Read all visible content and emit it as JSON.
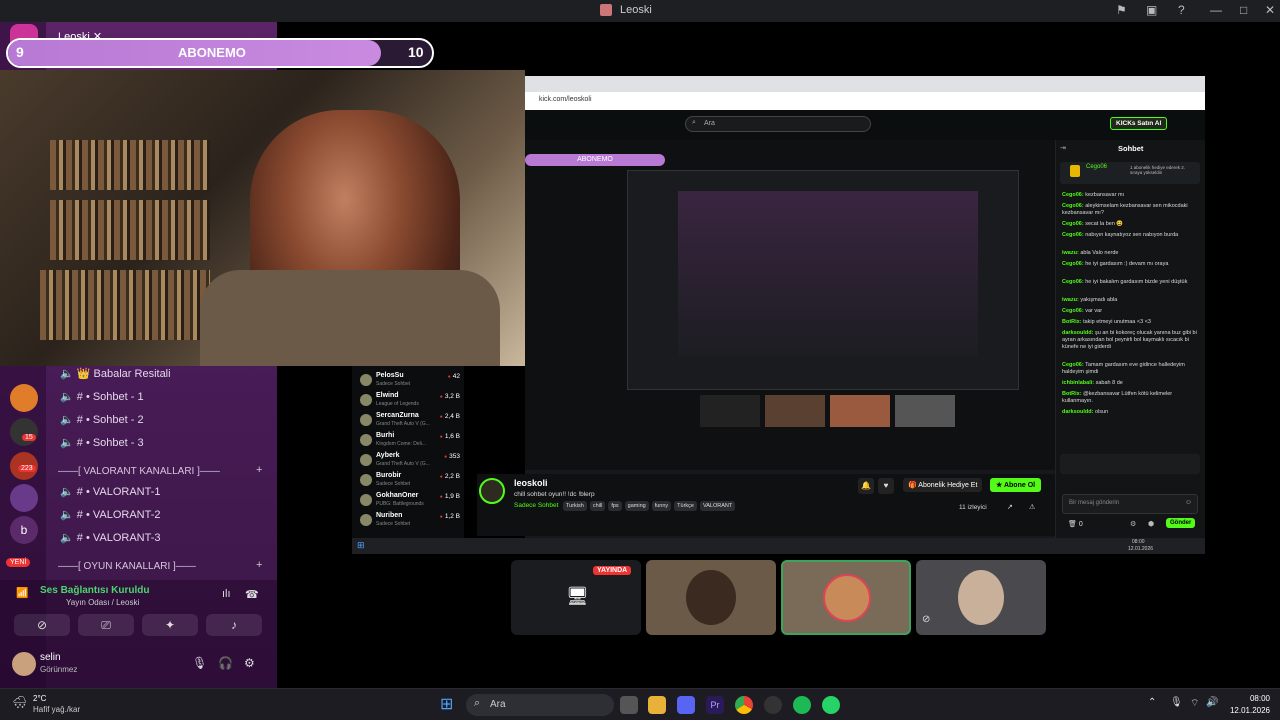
{
  "window": {
    "title": "Leoski"
  },
  "subgoal": {
    "left": "9",
    "label": "ABONEMO",
    "right": "10",
    "progress": 0.88
  },
  "discord": {
    "server_tab": "Leoski",
    "server_badges": [
      "15",
      "223"
    ],
    "new_badge": "YENİ",
    "channels": [
      {
        "label": "Babalar Resitali",
        "icon": "crown-icon"
      },
      {
        "label": "# • Sohbet - 1",
        "icon": "speaker-icon"
      },
      {
        "label": "# • Sohbet - 2",
        "icon": "speaker-icon"
      },
      {
        "label": "# • Sohbet - 3",
        "icon": "speaker-icon"
      }
    ],
    "cat_valorant": "——[ VALORANT KANALLARI ]——",
    "valorant_channels": [
      "# • VALORANT-1",
      "# • VALORANT-2",
      "# • VALORANT-3"
    ],
    "cat_oyun": "——[ OYUN KANALLARI ]——",
    "voice_status": "Ses Bağlantısı Kuruldu",
    "voice_sub": "Yayın Odası / Leoski",
    "user_name": "selin",
    "user_status": "Görünmez"
  },
  "browser": {
    "url": "kick.com/leoskoli",
    "search_placeholder": "Ara",
    "kicks_button": "KICKs Satın Al",
    "chat_title": "Sohbet",
    "top_gifter": "Cego06",
    "gift_text": "1 abonelik hediye ederek 2. sıraya yükseldin",
    "chat": [
      {
        "user": "Cego06:",
        "text": "kezbansavar mı"
      },
      {
        "user": "Cego06:",
        "text": "aleykimselam kezbansavar sen mikocdaki kezbansavar mı?"
      },
      {
        "user": "Cego06:",
        "text": "secat la ben 😆"
      },
      {
        "user": "Cego06:",
        "text": "nabıyın kaynatıyoz sen nabıyon burda"
      },
      {
        "user": "iwazu:",
        "text": "abla Valo nerde"
      },
      {
        "user": "Cego06:",
        "text": "he iyi gardasım :) devam mı oraya"
      },
      {
        "user": "Cego06:",
        "text": "he iyi bakalım gardasım bizde yeni düştük"
      },
      {
        "user": "iwazu:",
        "text": "yakışmadı abla"
      },
      {
        "user": "Cego06:",
        "text": "var var"
      },
      {
        "user": "BotRix:",
        "text": "takip etmeyi unutmaa <3 <3"
      },
      {
        "user": "darksouldd:",
        "text": "şu an bi kokoreç olucak yanına buz gibi bi ayran arkasından bol peynirli bol kaymaklı sıcacık bi künefe ne iyi giderdi"
      },
      {
        "user": "Cego06:",
        "text": "Tamam gardasım eve gidince halledeyim haldeyim şimdi"
      },
      {
        "user": "ichbinlabali:",
        "text": "sabah 8 de"
      },
      {
        "user": "BotRix:",
        "text": "@kezbansavar Lütfen kötü kelimeler kullanmayın."
      },
      {
        "user": "darksouldd:",
        "text": "olsun"
      }
    ],
    "chat_placeholder": "Bir mesaj gönderin",
    "chat_count": "0",
    "send_button": "Gönder",
    "streamer": "leoskoli",
    "stream_title": "chill sohbet oyun!! !dc !blerp",
    "stream_category": "Sadece Sohbet",
    "tags": [
      "Turkish",
      "chill",
      "fps",
      "gaming",
      "funny",
      "Türkçe",
      "VALORANT"
    ],
    "gift_button": "Abonelik Hediye Et",
    "sub_button": "Abone Ol",
    "viewers": "11 izleyici",
    "streams": [
      {
        "name": "PelosSu",
        "game": "Sadece Sohbet",
        "count": "42"
      },
      {
        "name": "Elwind",
        "game": "League of Legends",
        "count": "3,2 B"
      },
      {
        "name": "SercanZurna",
        "game": "Grand Theft Auto V (G...",
        "count": "2,4 B"
      },
      {
        "name": "Burhi",
        "game": "Kingdom Come: Deli...",
        "count": "1,6 B"
      },
      {
        "name": "Ayberk",
        "game": "Grand Theft Auto V (G...",
        "count": "353"
      },
      {
        "name": "Burobir",
        "game": "Sadece Sohbet",
        "count": "2,2 B"
      },
      {
        "name": "GokhanOner",
        "game": "PUBG: Battlegrounds",
        "count": "1,9 B"
      },
      {
        "name": "Nuriben",
        "game": "Sadece Sohbet",
        "count": "1,2 B"
      }
    ],
    "inner_clock": "08:00",
    "inner_date": "12.01.2026"
  },
  "tiles": {
    "live_badge": "YAYINDA"
  },
  "taskbar": {
    "weather_temp": "2°C",
    "weather_desc": "Hafif yağ./kar",
    "search": "Ara",
    "time": "08:00",
    "date": "12.01.2026"
  },
  "colors": {
    "kick_green": "#53fc18",
    "discord_purple": "#5a2467"
  }
}
